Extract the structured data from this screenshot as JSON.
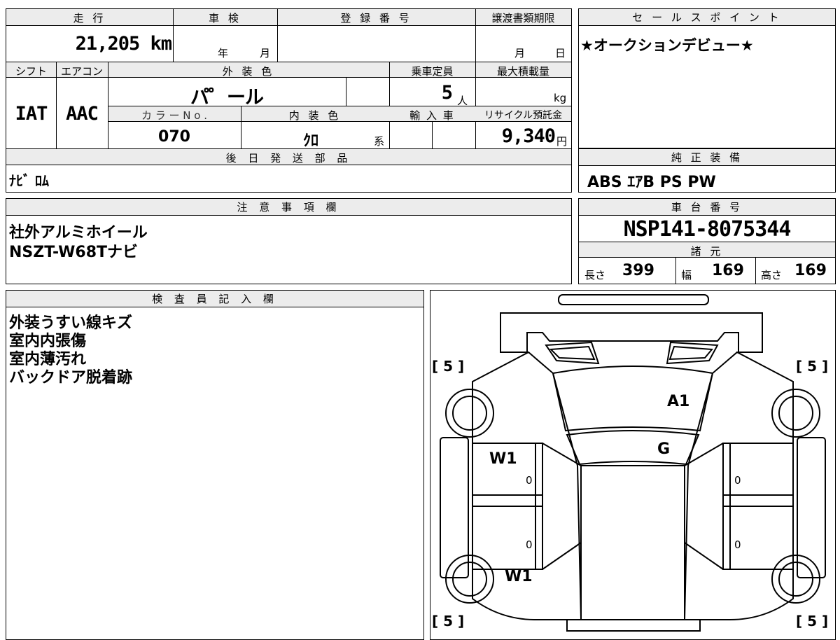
{
  "left_panel": {
    "mileage": {
      "header": "走 行",
      "value": "21,205",
      "unit": "km"
    },
    "inspection": {
      "header": "車 検",
      "year_unit": "年",
      "month_unit": "月"
    },
    "registration": {
      "header": "登 録 番 号",
      "value": ""
    },
    "transfer_deadline": {
      "header": "譲渡書類期限",
      "month_unit": "月",
      "day_unit": "日"
    },
    "shift": {
      "header": "シフト",
      "value": "IAT"
    },
    "aircon": {
      "header": "エアコン",
      "value": "AAC"
    },
    "exterior_color": {
      "header": "外 装 色",
      "value": "パ゜ール"
    },
    "capacity": {
      "header": "乗車定員",
      "value": "5",
      "unit": "人"
    },
    "max_load": {
      "header": "最大積載量",
      "unit": "kg"
    },
    "color_no": {
      "header": "カ ラ ー N o .",
      "value": "070"
    },
    "interior_color": {
      "header": "内 装 色",
      "value": "ｸﾛ",
      "suffix": "系"
    },
    "import": {
      "header": "輸 入 車"
    },
    "recycle": {
      "header": "リサイクル預託金",
      "value": "9,340",
      "unit": "円"
    },
    "later_parts": {
      "header": "後 日 発 送 部 品",
      "value": "ﾅﾋﾞ ﾛﾑ"
    }
  },
  "sales_point": {
    "header": "セ ー ル ス ポ イ ン ト",
    "text": "★オークションデビュー★"
  },
  "standard_equipment": {
    "header": "純 正 装 備",
    "value": "ABS ｴｱB PS PW"
  },
  "notes": {
    "header": "注 意 事 項 欄",
    "lines": [
      "社外アルミホイール",
      "NSZT-W68Tナビ"
    ]
  },
  "chassis": {
    "header": "車 台 番 号",
    "value": "NSP141-8075344"
  },
  "specs": {
    "header": "諸 元",
    "length_label": "長さ",
    "length": "399",
    "width_label": "幅",
    "width": "169",
    "height_label": "高さ",
    "height": "169"
  },
  "inspector": {
    "header": "検 査 員 記 入 欄",
    "lines": [
      "外装うすい線キズ",
      "室内内張傷",
      "室内薄汚れ",
      "バックドア脱着跡"
    ]
  },
  "diagram": {
    "tire_front_left": "[ 5 ]",
    "tire_front_right": "[ 5 ]",
    "tire_rear_left": "[ 5 ]",
    "tire_rear_right": "[ 5 ]",
    "mark_hood": "A1",
    "mark_windshield": "G",
    "mark_front_left_door": "W1",
    "mark_rear_left_door": "W1",
    "zero_1": "0",
    "zero_2": "0",
    "zero_3": "0",
    "zero_4": "0"
  }
}
